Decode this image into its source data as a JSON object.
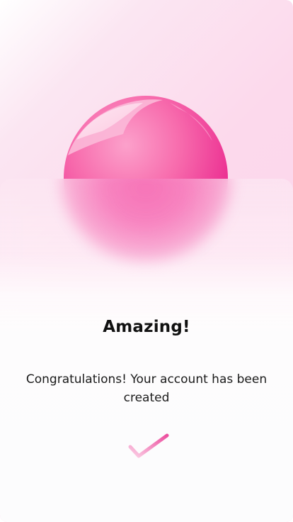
{
  "success_card": {
    "title": "Amazing!",
    "message": "Congratulations! Your account has been created"
  },
  "icons": {
    "hero": "pink-sphere-icon",
    "status": "checkmark-icon"
  },
  "colors": {
    "background_pink": "#fcd9ec",
    "sphere_pink": "#f23a9b",
    "accent_pink": "#ec5ea9",
    "text": "#111111"
  }
}
